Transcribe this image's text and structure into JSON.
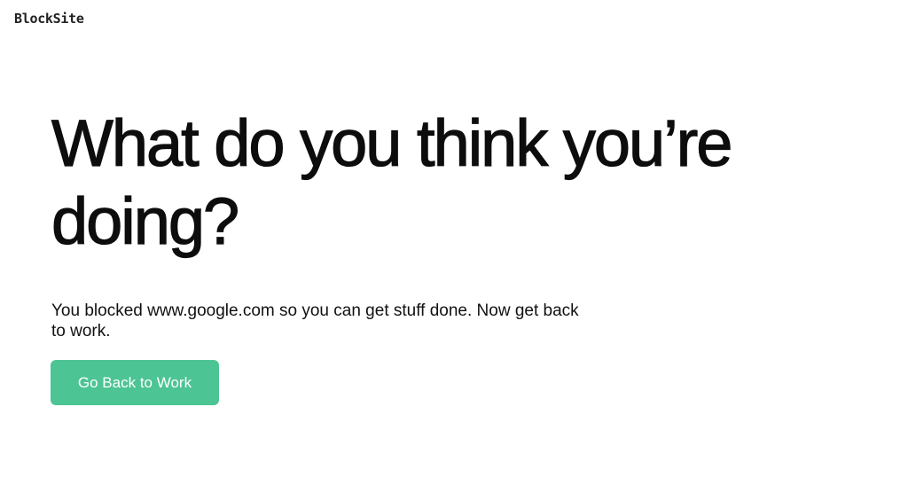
{
  "brand": {
    "logo_text": "BlockSite"
  },
  "main": {
    "headline": "What do you think you’re doing?",
    "message": "You blocked www.google.com so you can get stuff done. Now get back to work.",
    "button_label": "Go Back to Work"
  },
  "colors": {
    "button_background": "#4cc493",
    "button_text": "#ffffff",
    "text": "#111111",
    "background": "#ffffff"
  }
}
